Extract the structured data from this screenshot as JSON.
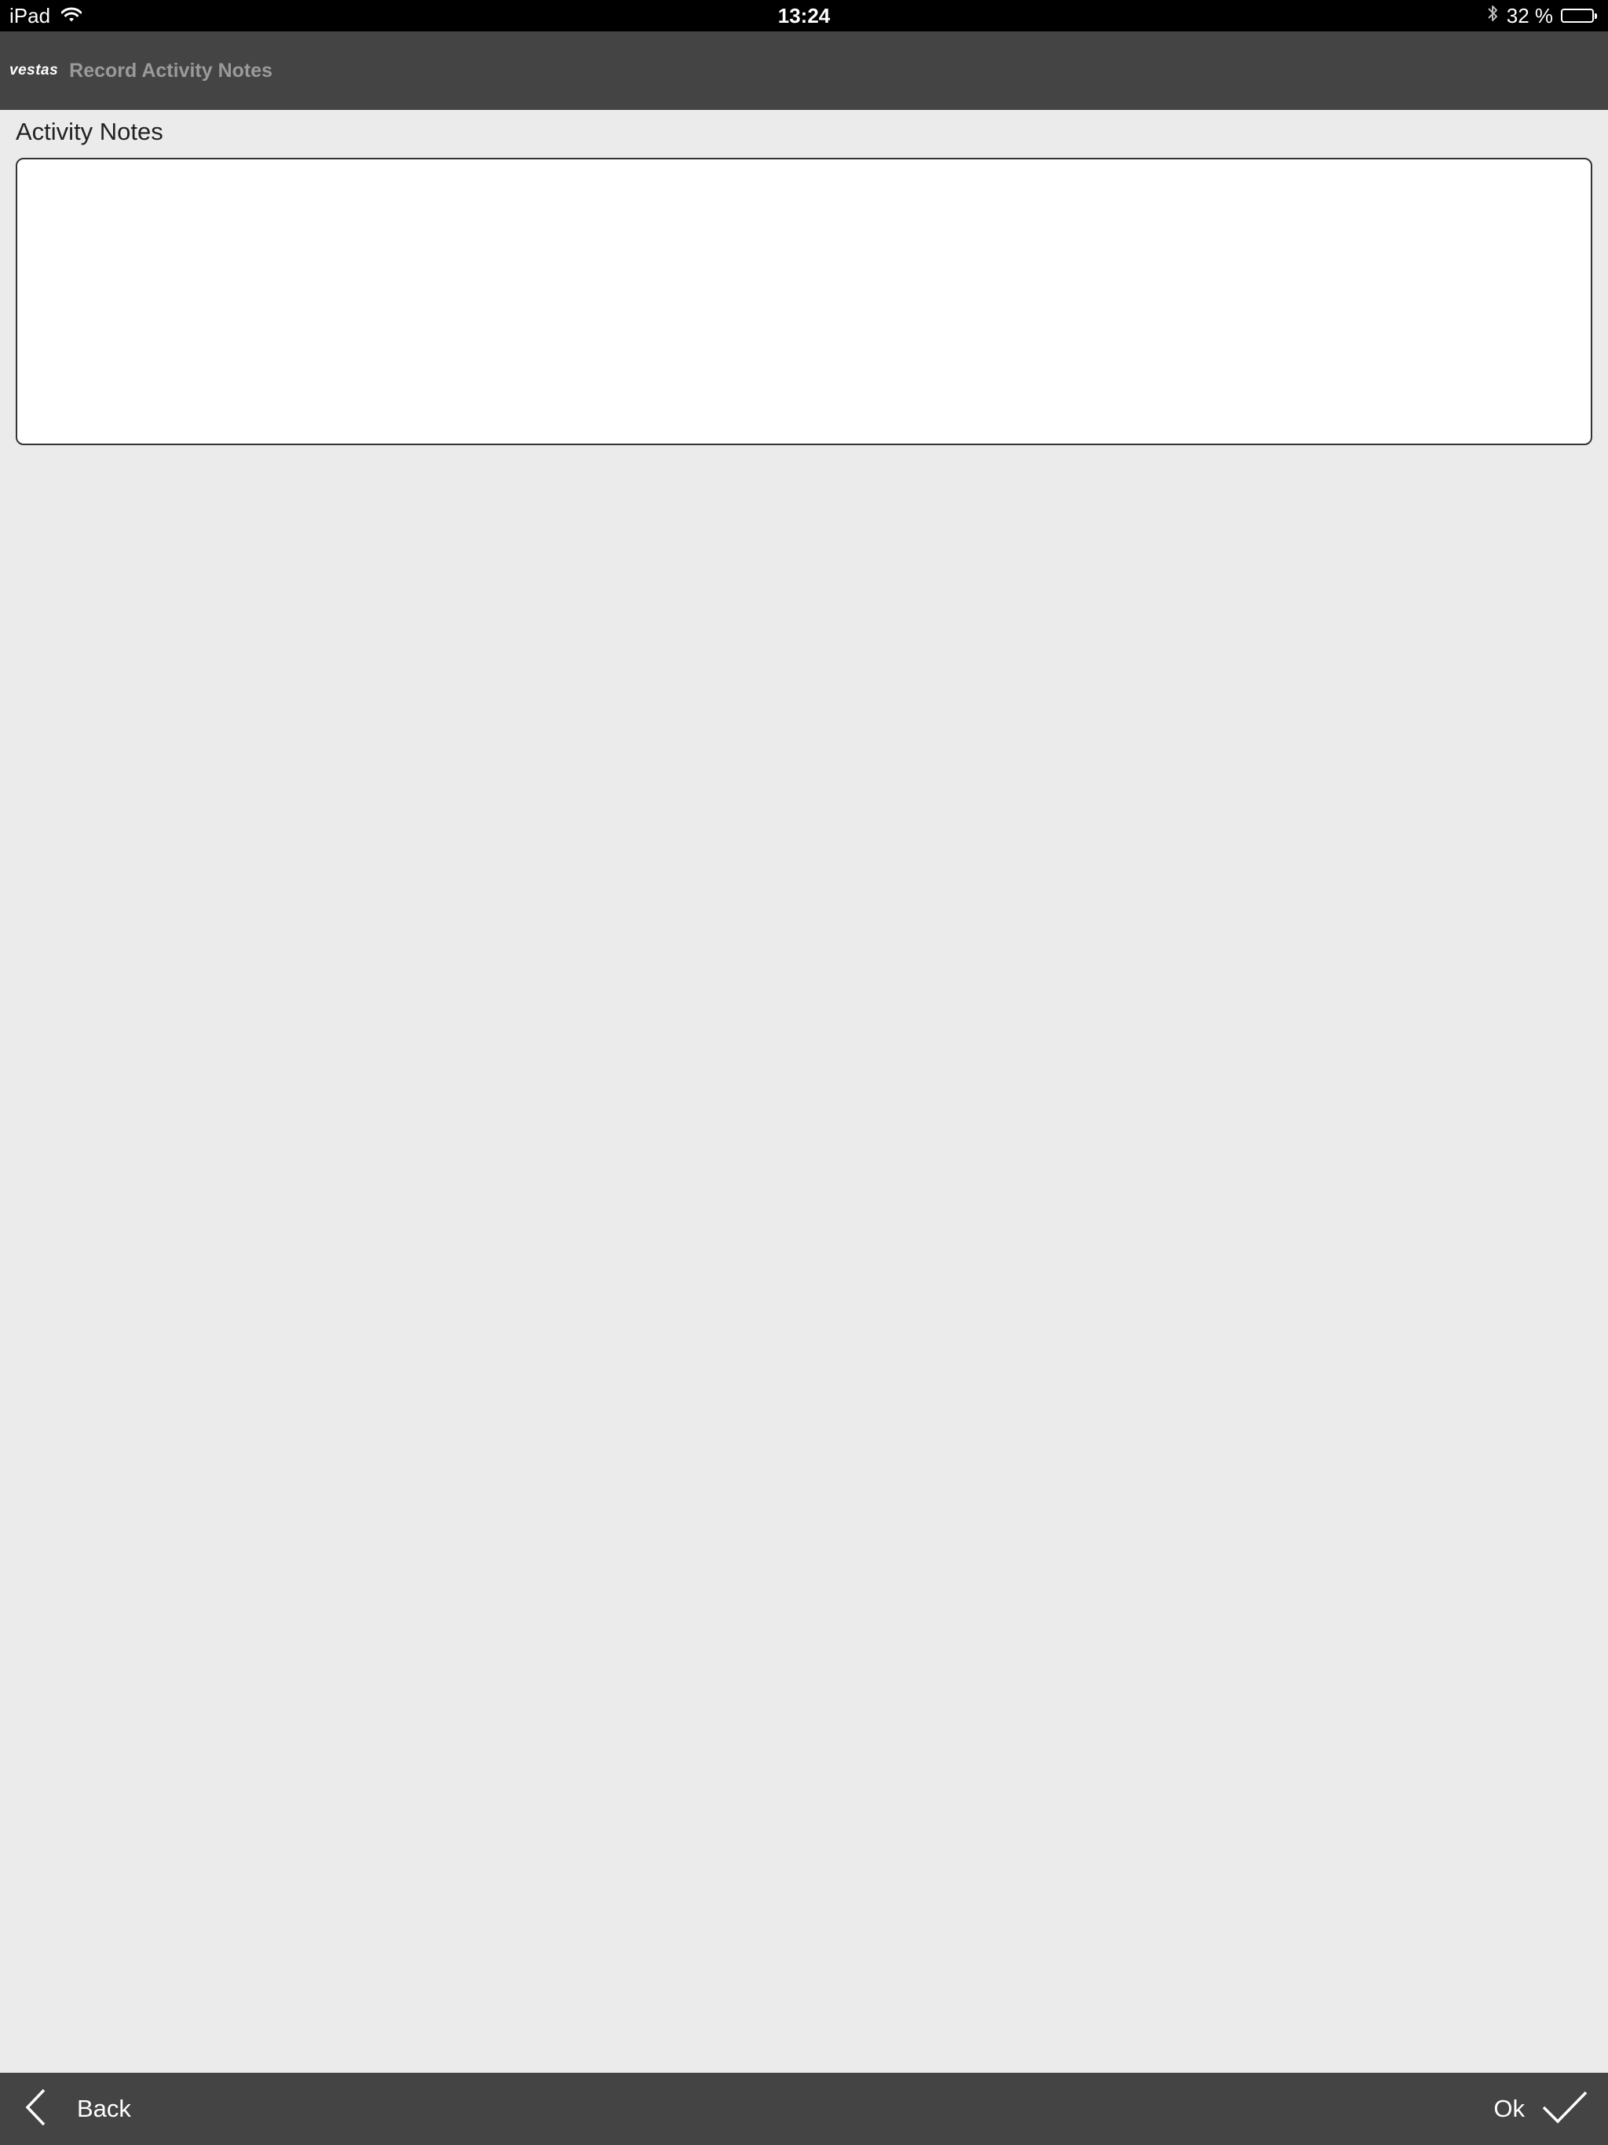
{
  "status_bar": {
    "device": "iPad",
    "time": "13:24",
    "battery_text": "32 %",
    "battery_level": 0.32,
    "icons": [
      "wifi-icon",
      "bluetooth-icon",
      "battery-icon"
    ]
  },
  "nav": {
    "logo_text": "vestas",
    "title": "Record Activity Notes"
  },
  "main": {
    "section_label": "Activity Notes",
    "notes_value": ""
  },
  "bottom_bar": {
    "back_label": "Back",
    "back_icon": "chevron-left-icon",
    "ok_label": "Ok",
    "ok_icon": "checkmark-icon"
  },
  "colors": {
    "status_bar_bg": "#000000",
    "nav_bg": "#444444",
    "page_bg": "#ebebeb",
    "title_text": "#9a9a9a"
  }
}
